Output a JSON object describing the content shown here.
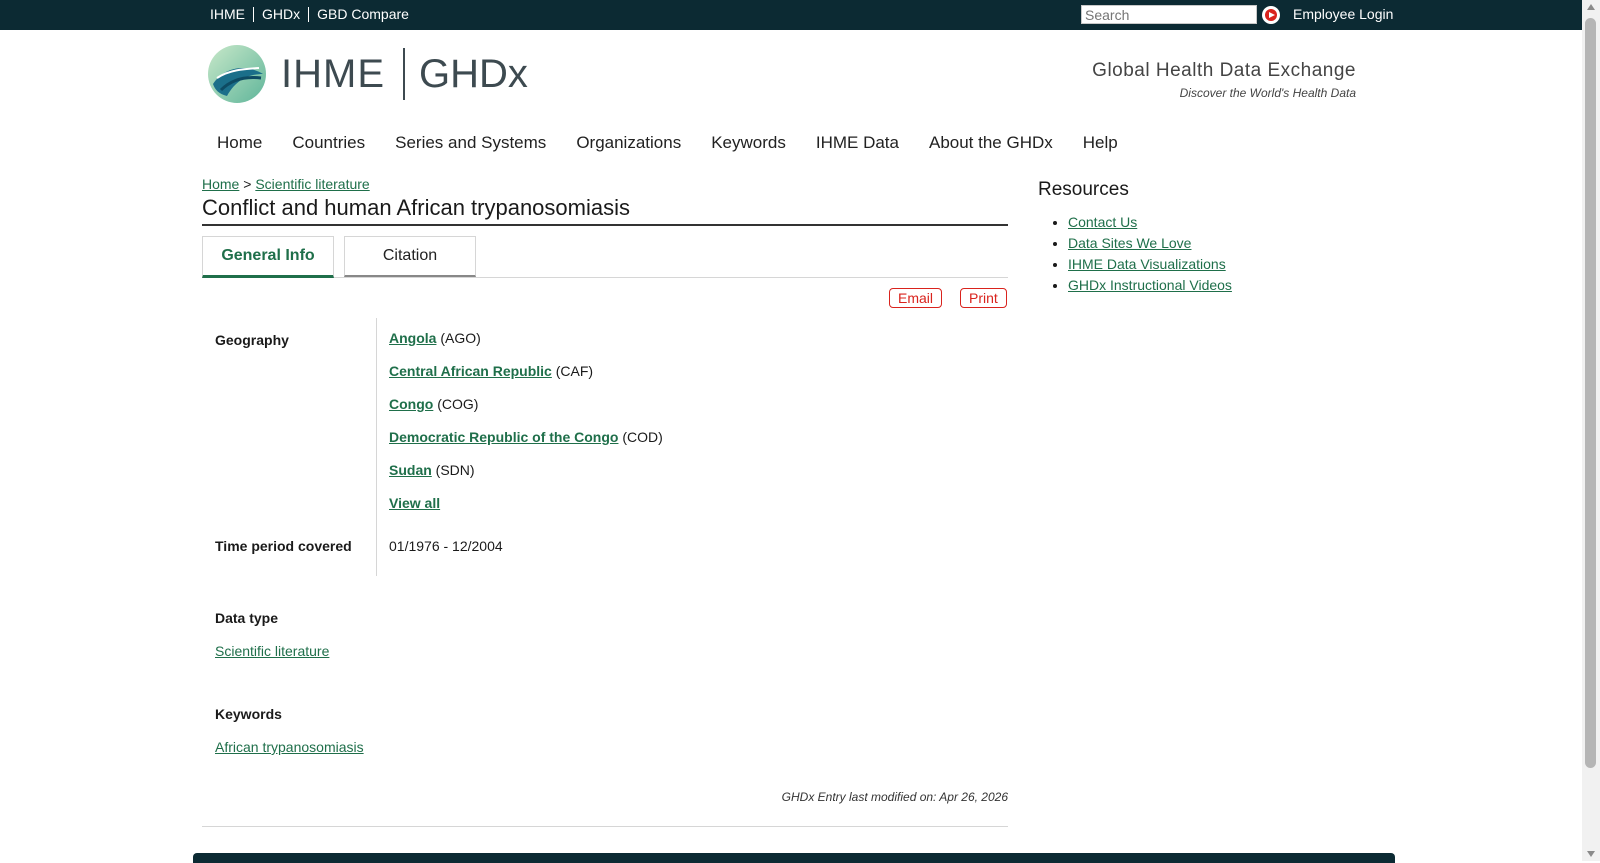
{
  "topbar": {
    "links": [
      "IHME",
      "GHDx",
      "GBD Compare"
    ],
    "search_placeholder": "Search",
    "employee_login": "Employee Login"
  },
  "header": {
    "logo_ihme": "IHME",
    "logo_ghdx": "GHDx",
    "tagline_title": "Global Health Data Exchange",
    "tagline_sub": "Discover the World's Health Data"
  },
  "nav": [
    "Home",
    "Countries",
    "Series and Systems",
    "Organizations",
    "Keywords",
    "IHME Data",
    "About the GHDx",
    "Help"
  ],
  "breadcrumb": {
    "home": "Home",
    "separator": ">",
    "current": "Scientific literature"
  },
  "page": {
    "title": "Conflict and human African trypanosomiasis",
    "tabs": {
      "general": "General Info",
      "citation": "Citation"
    },
    "email_label": "Email",
    "print_label": "Print"
  },
  "info": {
    "geography_label": "Geography",
    "geography": [
      {
        "name": "Angola",
        "code": "(AGO)"
      },
      {
        "name": "Central African Republic",
        "code": "(CAF)"
      },
      {
        "name": "Congo",
        "code": "(COG)"
      },
      {
        "name": "Democratic Republic of the Congo",
        "code": "(COD)"
      },
      {
        "name": "Sudan",
        "code": "(SDN)"
      }
    ],
    "view_all": "View all",
    "time_label": "Time period covered",
    "time_value": "01/1976 - 12/2004",
    "data_type_label": "Data type",
    "data_type_value": "Scientific literature",
    "keywords_label": "Keywords",
    "keywords_value": "African trypanosomiasis",
    "last_modified": "GHDx Entry last modified on: Apr 26, 2026"
  },
  "sidebar": {
    "title": "Resources",
    "links": [
      "Contact Us",
      "Data Sites We Love",
      "IHME Data Visualizations",
      "GHDx Instructional Videos"
    ]
  },
  "colors": {
    "topbar": "#0c2a33",
    "link_green": "#1f6f4a",
    "accent_red": "#d9231d"
  }
}
